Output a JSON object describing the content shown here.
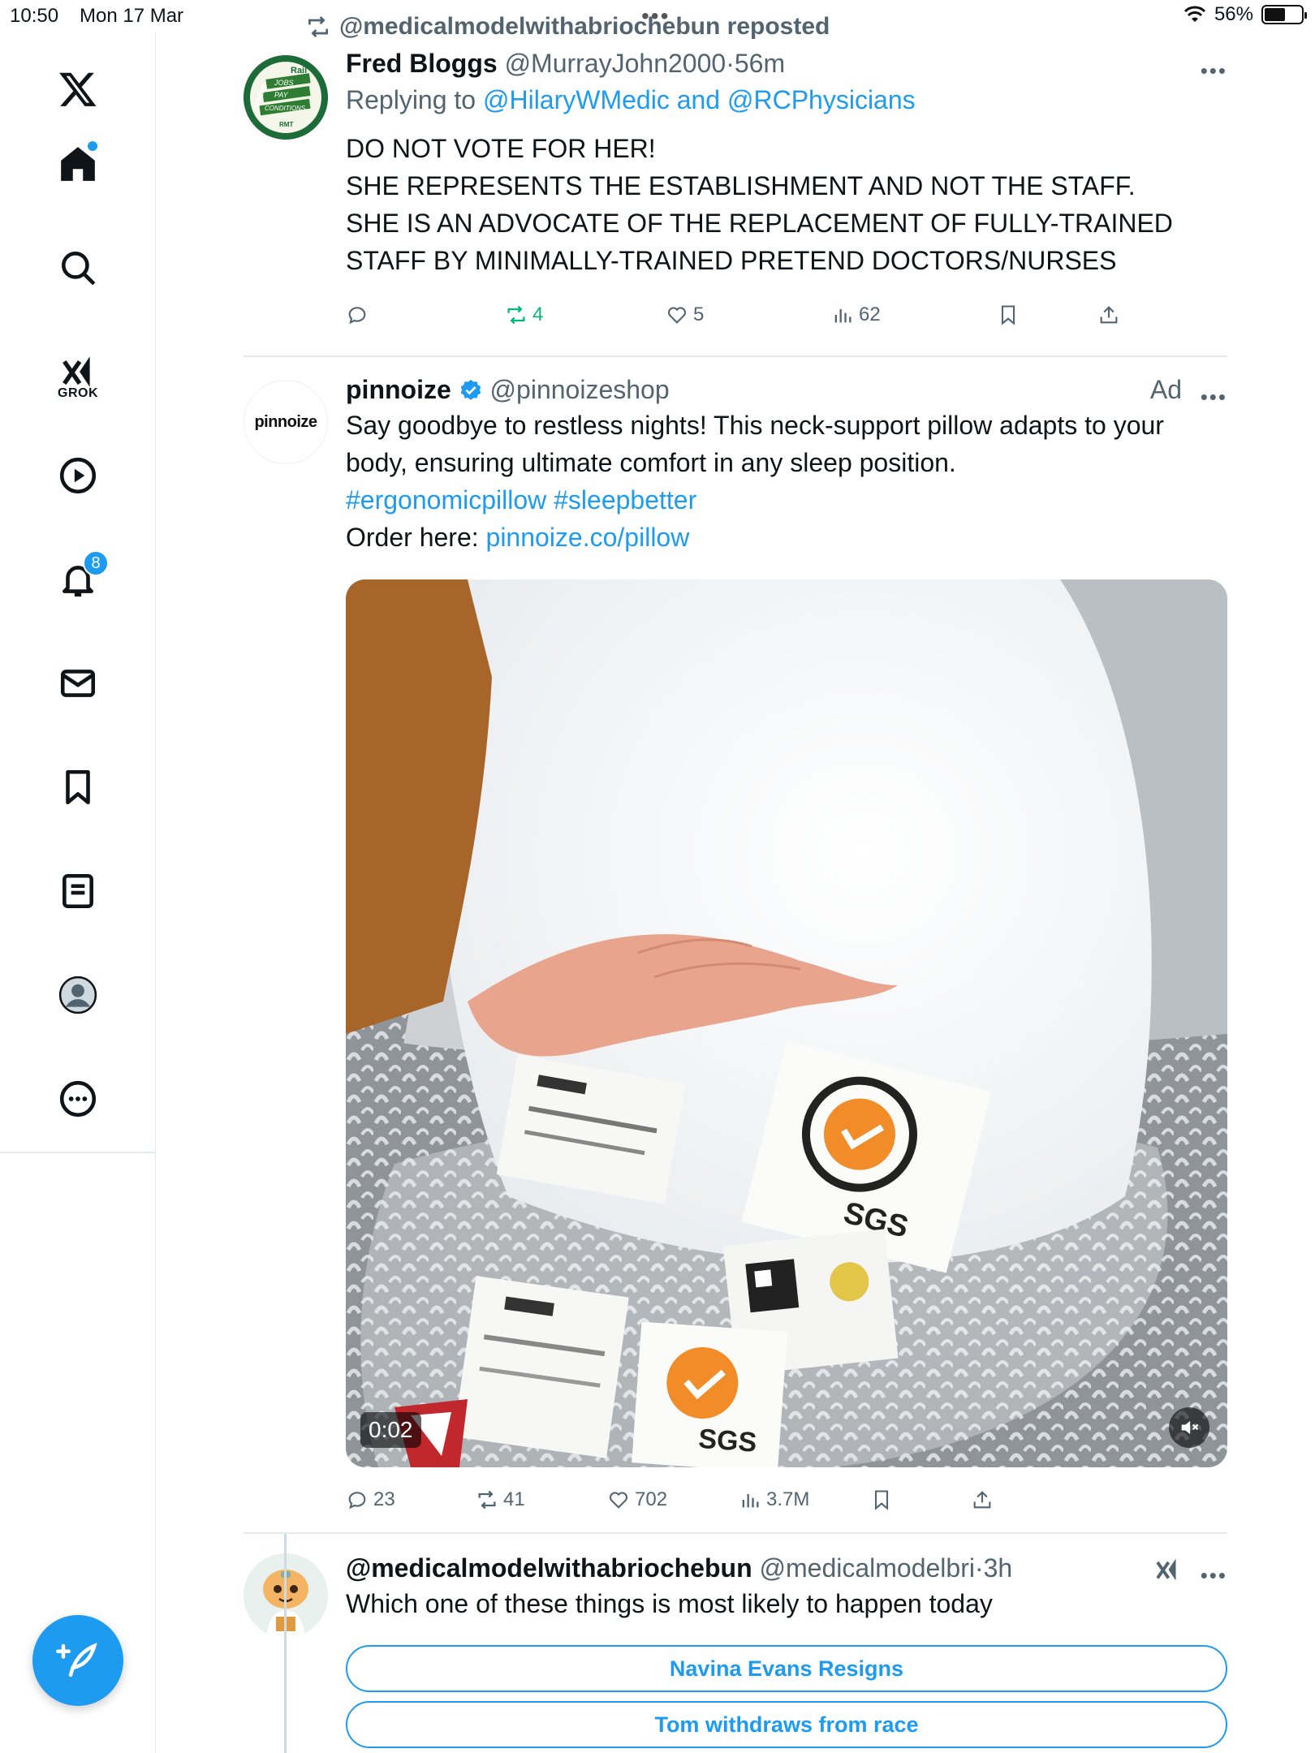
{
  "status_bar": {
    "time": "10:50",
    "date": "Mon 17 Mar",
    "battery": "56%",
    "battery_level": 0.56
  },
  "sidebar": {
    "grok_label": "GROK",
    "notifications_count": "8"
  },
  "tweet1": {
    "repost_label": "@medicalmodelwithabriochebun reposted",
    "name": "Fred Bloggs",
    "handle": "@MurrayJohn2000",
    "time": "56m",
    "replying_prefix": "Replying to",
    "replying_to": "@HilaryWMedic and @RCPhysicians",
    "lines": [
      "DO NOT VOTE FOR HER!",
      "SHE REPRESENTS THE ESTABLISHMENT AND NOT THE STAFF.",
      "SHE IS AN ADVOCATE OF THE REPLACEMENT OF FULLY-TRAINED",
      "STAFF BY MINIMALLY-TRAINED PRETEND DOCTORS/NURSES"
    ],
    "reposts": "4",
    "likes": "5",
    "views": "62",
    "avatar_text": {
      "rail": "Rail",
      "defend": "DEFEND",
      "jobs": "JOBS",
      "pay": "PAY",
      "conditions": "CONDITIONS",
      "rmt": "RMT"
    }
  },
  "tweet2": {
    "name": "pinnoize",
    "handle": "@pinnoizeshop",
    "ad_label": "Ad",
    "avatar_text": "pinnoize",
    "line1": "Say goodbye to restless nights! This neck-support pillow adapts to your",
    "line2": "body, ensuring ultimate comfort in any sleep position.",
    "hashtags": "#ergonomicpillow #sleepbetter",
    "order_prefix": "Order here:",
    "order_link": "pinnoize.co/pillow",
    "video_time": "0:02",
    "label_sgs": "SGS",
    "replies": "23",
    "reposts": "41",
    "likes": "702",
    "views": "3.7M"
  },
  "tweet3": {
    "name": "@medicalmodelwithabriochebun",
    "handle": "@medicalmodelbri",
    "time": "3h",
    "text": "Which one of these things is most likely to happen today",
    "poll_options": [
      "Navina Evans Resigns",
      "Tom withdraws from race"
    ]
  },
  "colors": {
    "accent": "#1d9bf0",
    "repost_green": "#00ba7c",
    "muted": "#536471"
  }
}
